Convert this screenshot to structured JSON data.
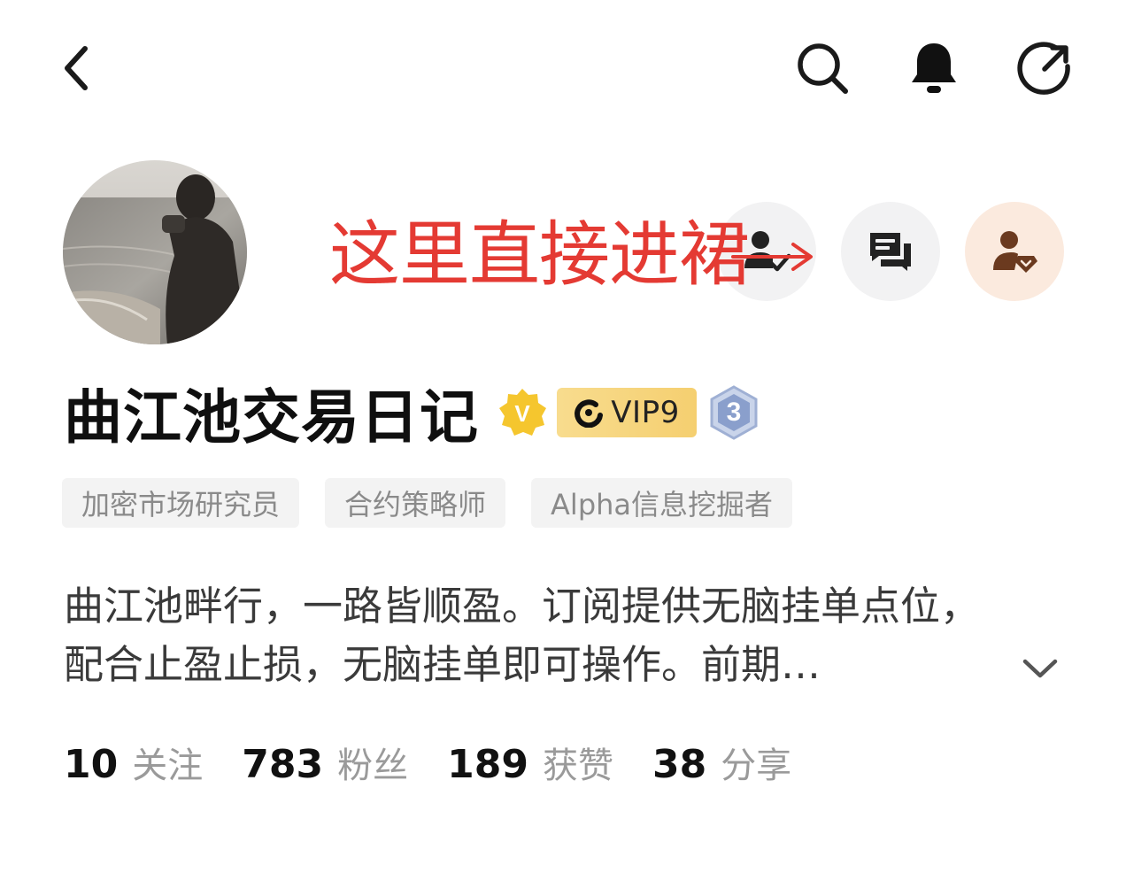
{
  "header": {
    "back_icon": "chevron-left-icon",
    "search_icon": "search-icon",
    "bell_icon": "bell-icon",
    "share_icon": "share-arrow-icon"
  },
  "profile": {
    "avatar": "person-at-seaside-photo",
    "name": "曲江池交易日记",
    "verified_icon": "verified-v-icon",
    "vip_label": "VIP9",
    "level": "3",
    "tags": [
      "加密市场研究员",
      "合约策略师",
      "Alpha信息挖掘者"
    ],
    "bio_lines": [
      "曲江池畔行，一路皆顺盈。订阅提供无脑挂单点位，",
      "配合止盈止损，无脑挂单即可操作。前期…"
    ],
    "stats": [
      {
        "value": "10",
        "label": "关注"
      },
      {
        "value": "783",
        "label": "粉丝"
      },
      {
        "value": "189",
        "label": "获赞"
      },
      {
        "value": "38",
        "label": "分享"
      }
    ]
  },
  "actions": {
    "follow_icon": "user-check-icon",
    "message_icon": "chat-bubbles-icon",
    "subscribe_icon": "user-diamond-icon"
  },
  "annotation": {
    "text": "这里直接进裙",
    "color": "#e43a33"
  },
  "colors": {
    "accent_gold": "#f5c62e",
    "vip_bg": "#f6d57e",
    "subscribe_bg": "#fbeade",
    "subscribe_icon": "#6b3a1f"
  }
}
